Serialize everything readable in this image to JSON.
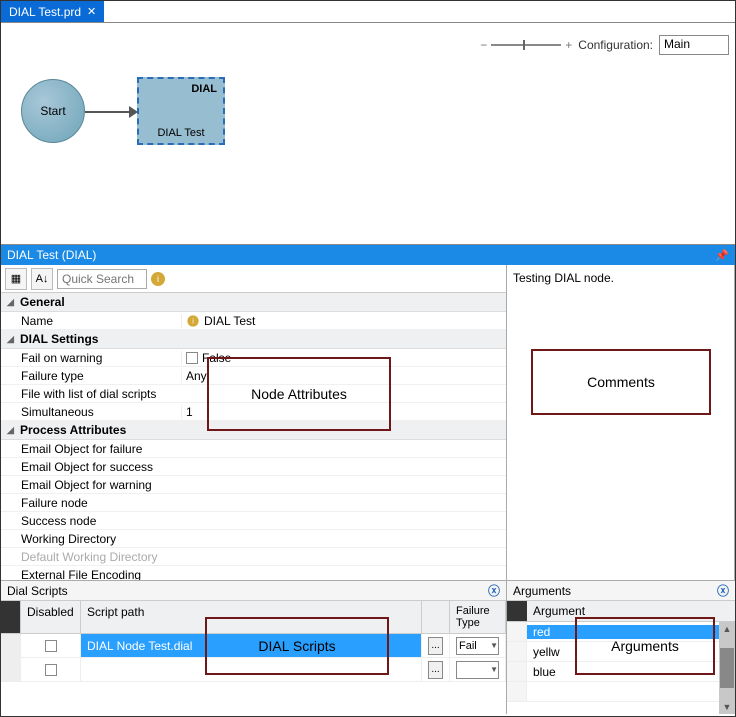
{
  "tab": {
    "title": "DIAL Test.prd"
  },
  "config": {
    "label": "Configuration:",
    "value": "Main"
  },
  "canvas": {
    "start_label": "Start",
    "dial_type": "DIAL",
    "dial_label": "DIAL Test"
  },
  "panel": {
    "title": "DIAL Test (DIAL)"
  },
  "toolbar": {
    "search_placeholder": "Quick Search"
  },
  "props": {
    "general": {
      "cat": "General",
      "name_label": "Name",
      "name_value": "DIAL Test"
    },
    "dial": {
      "cat": "DIAL Settings",
      "fail_warn_label": "Fail on warning",
      "fail_warn_value": "False",
      "fail_type_label": "Failure type",
      "fail_type_value": "Any",
      "file_list_label": "File with list of dial scripts",
      "sim_label": "Simultaneous",
      "sim_value": "1"
    },
    "proc": {
      "cat": "Process Attributes",
      "email_fail": "Email Object for failure",
      "email_succ": "Email Object for success",
      "email_warn": "Email Object for warning",
      "fail_node": "Failure node",
      "succ_node": "Success node",
      "workdir": "Working Directory",
      "def_workdir": "Default Working Directory",
      "ext_enc": "External File Encoding"
    }
  },
  "comments": {
    "text": "Testing DIAL node."
  },
  "scripts": {
    "title": "Dial Scripts",
    "col_disabled": "Disabled",
    "col_script": "Script path",
    "col_failtype_l1": "Failure",
    "col_failtype_l2": "Type",
    "row1_script": "DIAL Node Test.dial",
    "row1_fail": "Fail",
    "browse": "..."
  },
  "args": {
    "title": "Arguments",
    "col": "Argument",
    "rows": [
      "red",
      "yellw",
      "blue"
    ]
  },
  "overlay": {
    "attrs": "Node Attributes",
    "comments": "Comments",
    "scripts": "DIAL Scripts",
    "args": "Arguments"
  }
}
